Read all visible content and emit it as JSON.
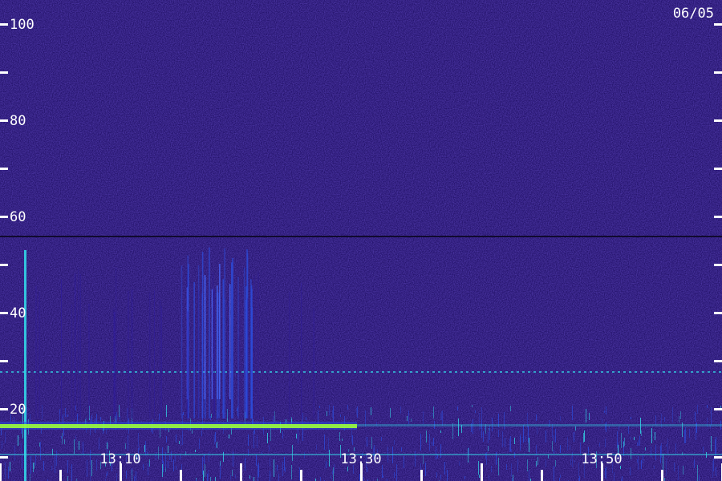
{
  "chart_data": {
    "type": "heatmap",
    "title": "",
    "date": "06/05",
    "xlabel": "",
    "ylabel": "",
    "x_ticks": [
      "13:10",
      "13:30",
      "13:50"
    ],
    "y_ticks": [
      "100",
      "80",
      "60",
      "40",
      "20"
    ],
    "ylim": [
      0,
      100
    ],
    "xlim_minutes": [
      13.0,
      14.0
    ],
    "colors": {
      "background": "#23126a",
      "low": "#2c1aa0",
      "mid": "#2d4bd8",
      "high": "#33d6e8",
      "peak": "#9bff3a",
      "text": "#ffffff"
    },
    "features": {
      "strong_horizontal_band_y": 17,
      "dark_horizontal_line_y": 56,
      "cyan_dashed_line_y": 28,
      "vertical_burst_cluster_time": [
        "13:15",
        "13:21"
      ],
      "single_spike_time": "13:02"
    }
  }
}
